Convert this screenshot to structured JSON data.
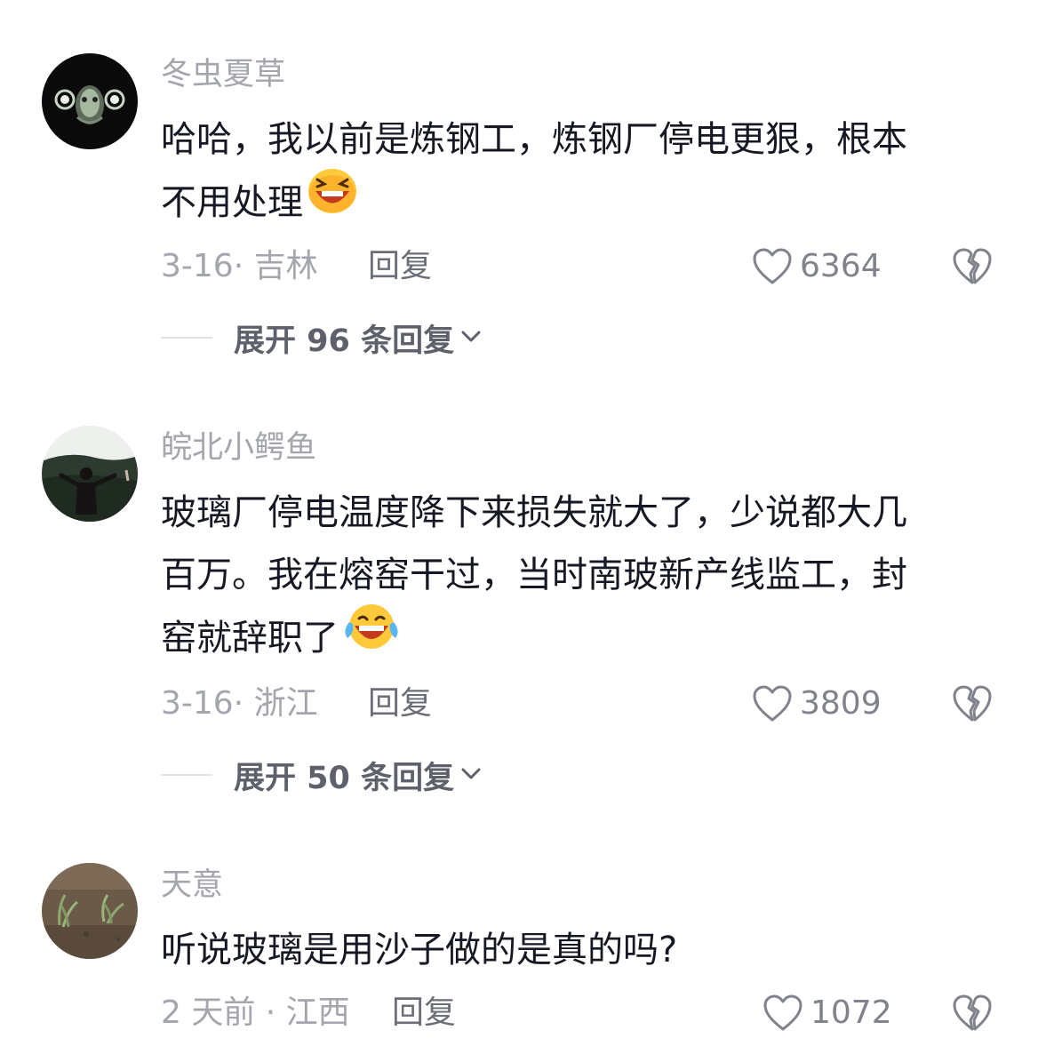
{
  "comments": [
    {
      "username": "冬虫夏草",
      "lines": [
        "哈哈，我以前是炼钢工，炼钢厂停电更狠，根本",
        "不用处理"
      ],
      "date_location": "3-16· 吉林",
      "reply_label": "回复",
      "likes": "6364",
      "expand_label": "展开 96 条回复",
      "avatar_icon": "glowing-mask-avatar",
      "emoji": "laughing-squint-emoji"
    },
    {
      "username": "皖北小鳄鱼",
      "lines": [
        "玻璃厂停电温度降下来损失就大了，少说都大几",
        "百万。我在熔窑干过，当时南玻新产线监工，封",
        "窑就辞职了"
      ],
      "date_location": "3-16· 浙江",
      "reply_label": "回复",
      "likes": "3809",
      "expand_label": "展开 50 条回复",
      "avatar_icon": "person-outdoors-avatar",
      "emoji": "tears-of-joy-emoji"
    },
    {
      "username": "天意",
      "lines": [
        "听说玻璃是用沙子做的是真的吗?"
      ],
      "date_location": "2 天前 · 江西",
      "reply_label": "回复",
      "likes": "1072",
      "avatar_icon": "field-plants-avatar"
    }
  ],
  "colors": {
    "text_primary": "#161823",
    "text_secondary": "#a4a6ad",
    "expand_text": "#5e616b"
  }
}
